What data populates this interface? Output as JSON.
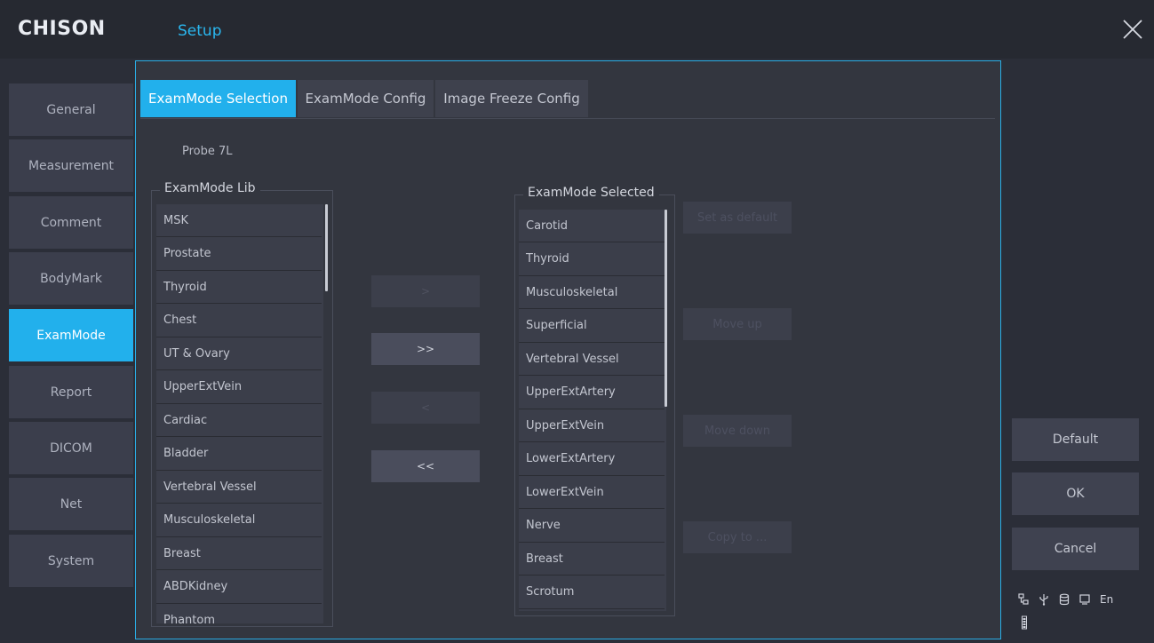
{
  "header": {
    "logo": "CHISON",
    "title": "Setup"
  },
  "nav": {
    "items": [
      {
        "label": "General"
      },
      {
        "label": "Measurement"
      },
      {
        "label": "Comment"
      },
      {
        "label": "BodyMark"
      },
      {
        "label": "ExamMode",
        "active": true
      },
      {
        "label": "Report"
      },
      {
        "label": "DICOM"
      },
      {
        "label": "Net"
      },
      {
        "label": "System"
      }
    ]
  },
  "tabs": [
    {
      "label": "ExamMode Selection",
      "active": true
    },
    {
      "label": "ExamMode Config"
    },
    {
      "label": "Image Freeze Config"
    }
  ],
  "probe": "Probe 7L",
  "lib": {
    "title": "ExamMode Lib",
    "items": [
      "MSK",
      "Prostate",
      "Thyroid",
      "Chest",
      "UT & Ovary",
      "UpperExtVein",
      "Cardiac",
      "Bladder",
      "Vertebral Vessel",
      "Musculoskeletal",
      "Breast",
      "ABDKidney",
      "Phantom"
    ]
  },
  "selected": {
    "title": "ExamMode Selected",
    "items": [
      "Carotid",
      "Thyroid",
      "Musculoskeletal",
      "Superficial",
      "Vertebral Vessel",
      "UpperExtArtery",
      "UpperExtVein",
      "LowerExtArtery",
      "LowerExtVein",
      "Nerve",
      "Breast",
      "Scrotum"
    ]
  },
  "transfer": {
    "add": ">",
    "add_all": ">>",
    "remove": "<",
    "remove_all": "<<"
  },
  "side_actions": {
    "set_default": "Set as default",
    "move_up": "Move up",
    "move_down": "Move down",
    "copy_to": "Copy to ..."
  },
  "actions": {
    "default": "Default",
    "ok": "OK",
    "cancel": "Cancel"
  },
  "status": {
    "language": "En",
    "icons": [
      "network-icon",
      "usb-icon",
      "storage-icon",
      "monitor-icon",
      "battery-icon"
    ]
  },
  "colors": {
    "accent": "#22b0ec",
    "background": "#2b2e38",
    "panel": "#33363f"
  }
}
